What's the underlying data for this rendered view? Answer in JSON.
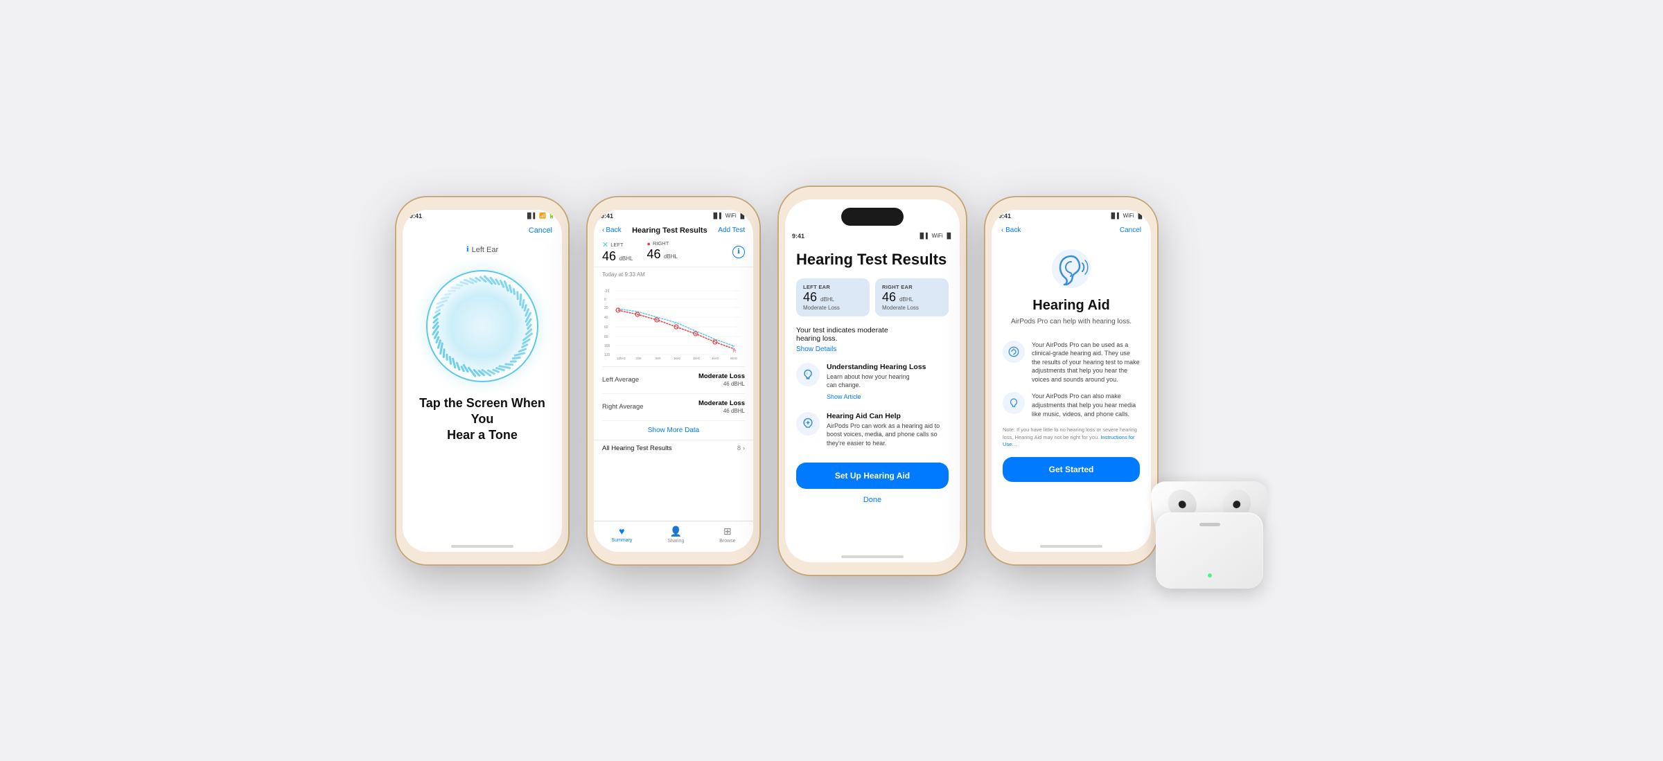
{
  "bg_color": "#f0f0f2",
  "accent_color": "#007AFF",
  "phone1": {
    "status_time": "9:41",
    "cancel_label": "Cancel",
    "ear_label": "Left Ear",
    "instruction": "Tap the Screen When You\nHear a Tone"
  },
  "phone2": {
    "status_time": "9:41",
    "back_label": "Back",
    "nav_title": "Hearing Test Results",
    "add_label": "Add Test",
    "left_label": "LEFT",
    "right_label": "RIGHT",
    "left_value": "46",
    "right_value": "46",
    "unit": "dBHL",
    "time": "Today at 9:33 AM",
    "left_avg_label": "Left Average",
    "left_avg_result": "Moderate Loss",
    "left_avg_value": "46 dBHL",
    "right_avg_label": "Right Average",
    "right_avg_result": "Moderate Loss",
    "right_avg_value": "46 dBHL",
    "show_more": "Show More Data",
    "all_results_label": "All Hearing Test Results",
    "all_results_count": "8",
    "tab_summary": "Summary",
    "tab_sharing": "Sharing",
    "tab_browse": "Browse",
    "chart_y_labels": [
      "-20",
      "0",
      "20",
      "40",
      "60",
      "80",
      "100",
      "120"
    ],
    "chart_x_labels": [
      "125Hz",
      "250",
      "500",
      "1kHz",
      "2kHz",
      "4kHz",
      "8kHz"
    ]
  },
  "phone3": {
    "status_time": "9:41",
    "title": "Hearing Test Results",
    "left_ear_label": "LEFT EAR",
    "left_ear_value": "46 dBHL",
    "left_ear_sub": "Moderate Loss",
    "right_ear_label": "RIGHT EAR",
    "right_ear_value": "46 dBHL",
    "right_ear_sub": "Moderate Loss",
    "desc": "Your test indicates moderate\nhearing loss.",
    "show_details": "Show Details",
    "info1_title": "Understanding Hearing Loss",
    "info1_body": "Learn about how your hearing\ncan change.",
    "info1_link": "Show Article",
    "info2_title": "Hearing Aid Can Help",
    "info2_body": "AirPods Pro can work as a hearing aid to boost voices, media, and phone calls so they're easier to hear.",
    "btn_label": "Set Up Hearing Aid",
    "done_label": "Done"
  },
  "phone4": {
    "status_time": "9:41",
    "back_label": "Back",
    "cancel_label": "Cancel",
    "title": "Hearing Aid",
    "subtitle": "AirPods Pro can help with hearing loss.",
    "info1_body": "Your AirPods Pro can be used as a clinical-grade hearing aid. They use the results of your hearing test to make adjustments that help you hear the voices and sounds around you.",
    "info2_body": "Your AirPods Pro can also make adjustments that help you hear media like music, videos, and phone calls.",
    "note": "Note: If you have little to no hearing loss or severe hearing loss, Hearing Aid may not be right for you.",
    "instructions_link": "Instructions for Use…",
    "btn_label": "Get Started"
  }
}
